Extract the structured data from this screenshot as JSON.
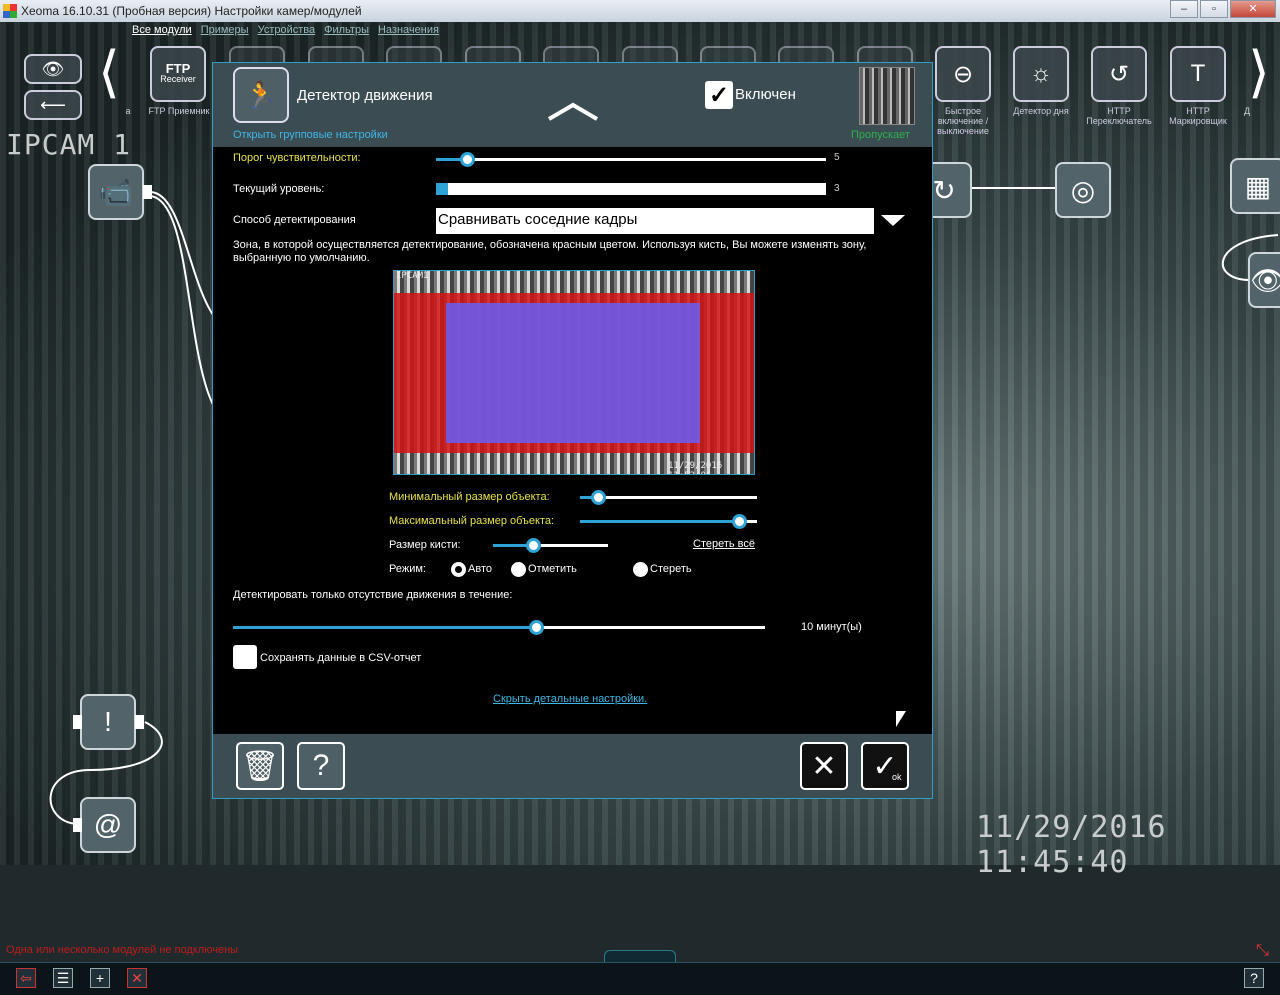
{
  "window": {
    "title": "Xeoma 16.10.31 (Пробная версия) Настройки камер/модулей"
  },
  "menu": {
    "items": [
      "Все модули",
      "Примеры",
      "Устройства",
      "Фильтры",
      "Назначения"
    ]
  },
  "strip": {
    "left_label_a": "a",
    "ftp_label": "FTP Приемник",
    "ftp_badge": "FTP",
    "ftp_badge_sub": "Receiver",
    "quick_label": "Быстрое включение / выключение",
    "day_label": "Детектор дня",
    "http_switch_label": "HTTP Переключатель",
    "http_marker_label": "HTTP Маркировщик",
    "right_label_d": "Д"
  },
  "camera": {
    "name": "IPCAM 1",
    "timestamp": "11/29/2016  11:45:40"
  },
  "dialog": {
    "title": "Детектор движения",
    "group_link": "Открыть групповые настройки",
    "enabled_label": "Включен",
    "skips_label": "Пропускает",
    "sensitivity": {
      "label": "Порог чувствительности:",
      "value": "5",
      "fraction": 0.08
    },
    "current_level": {
      "label": "Текущий уровень:",
      "value": "3",
      "fraction": 0.03
    },
    "method": {
      "label": "Способ детектирования",
      "value": "Сравнивать соседние кадры"
    },
    "zone_hint": "Зона, в которой осуществляется детектирование, обозначена красным цветом. Используя кисть, Вы можете изменять зону, выбранную по умолчанию.",
    "preview": {
      "cam_label": "IPCAM1",
      "timestamp": "11/29/2016 11:52:06"
    },
    "min_size": {
      "label": "Минимальный размер объекта:",
      "fraction": 0.1
    },
    "max_size": {
      "label": "Максимальный размер объекта:",
      "fraction": 0.9
    },
    "brush": {
      "label": "Размер кисти:",
      "fraction": 0.35,
      "clear_all": "Стереть всё"
    },
    "mode": {
      "label": "Режим:",
      "options": [
        "Авто",
        "Отметить",
        "Стереть"
      ],
      "selected": "Авто"
    },
    "absence": {
      "label": "Детектировать только отсутствие движения в течение:",
      "value": "10 минут(ы)",
      "fraction": 0.57
    },
    "csv_label": "Сохранять данные в CSV-отчет",
    "hide_link": "Скрыть детальные настройки.",
    "ok_tag": "ok"
  },
  "status": {
    "warning": "Одна или несколько модулей не подключены"
  },
  "colors": {
    "accent": "#2fa3d6",
    "link": "#3fb8e6",
    "warning": "#c01b1b",
    "skips": "#2bb24c",
    "yellow_label": "#e6e24a"
  }
}
